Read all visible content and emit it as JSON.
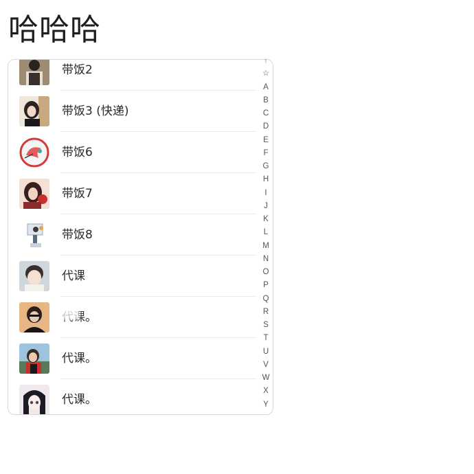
{
  "header": {
    "title": "哈哈哈"
  },
  "contacts": [
    {
      "name": "带饭2"
    },
    {
      "name": "带饭3 (快递)"
    },
    {
      "name": "带饭6"
    },
    {
      "name": "带饭7"
    },
    {
      "name": "带饭8"
    },
    {
      "name": "代课"
    },
    {
      "name": "代课。"
    },
    {
      "name": "代课。"
    },
    {
      "name": "代课。"
    }
  ],
  "index_bar": [
    "↑",
    "☆",
    "A",
    "B",
    "C",
    "D",
    "E",
    "F",
    "G",
    "H",
    "I",
    "J",
    "K",
    "L",
    "M",
    "N",
    "O",
    "P",
    "Q",
    "R",
    "S",
    "T",
    "U",
    "V",
    "W",
    "X",
    "Y"
  ]
}
